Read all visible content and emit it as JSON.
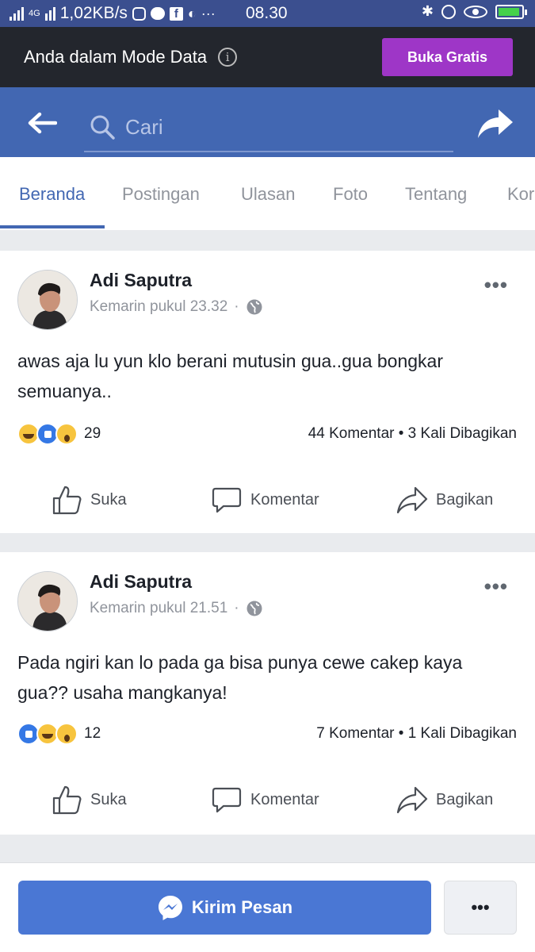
{
  "status_bar": {
    "network_speed": "1,02KB/s",
    "network_type": "4G",
    "time": "08.30"
  },
  "data_mode": {
    "message": "Anda dalam Mode Data",
    "button_label": "Buka Gratis"
  },
  "search": {
    "placeholder": "Cari"
  },
  "tabs": [
    {
      "label": "Beranda",
      "active": true
    },
    {
      "label": "Postingan"
    },
    {
      "label": "Ulasan"
    },
    {
      "label": "Foto"
    },
    {
      "label": "Tentang"
    },
    {
      "label": "Kor"
    }
  ],
  "posts": [
    {
      "author": "Adi Saputra",
      "timestamp": "Kemarin pukul 23.32",
      "separator": "·",
      "more": "•••",
      "text": "awas aja lu yun klo berani mutusin gua..gua bongkar semuanya..",
      "reactions": [
        "haha",
        "like",
        "wow"
      ],
      "reaction_count": "29",
      "stats": "44 Komentar • 3 Kali Dibagikan",
      "actions": {
        "like": "Suka",
        "comment": "Komentar",
        "share": "Bagikan"
      }
    },
    {
      "author": "Adi Saputra",
      "timestamp": "Kemarin pukul 21.51",
      "separator": "·",
      "more": "•••",
      "text": "Pada ngiri kan lo pada ga bisa punya cewe cakep kaya gua?? usaha mangkanya!",
      "reactions": [
        "like",
        "haha",
        "wow"
      ],
      "reaction_count": "12",
      "stats": "7 Komentar • 1 Kali Dibagikan",
      "actions": {
        "like": "Suka",
        "comment": "Komentar",
        "share": "Bagikan"
      }
    }
  ],
  "bottom_bar": {
    "send_message_label": "Kirim Pesan",
    "more_label": "•••"
  },
  "colors": {
    "brand_blue": "#4267b2",
    "button_blue": "#4a77d4",
    "buka_purple": "#9e36c7",
    "status_bar": "#3b4f8f",
    "data_bar": "#23262d"
  }
}
